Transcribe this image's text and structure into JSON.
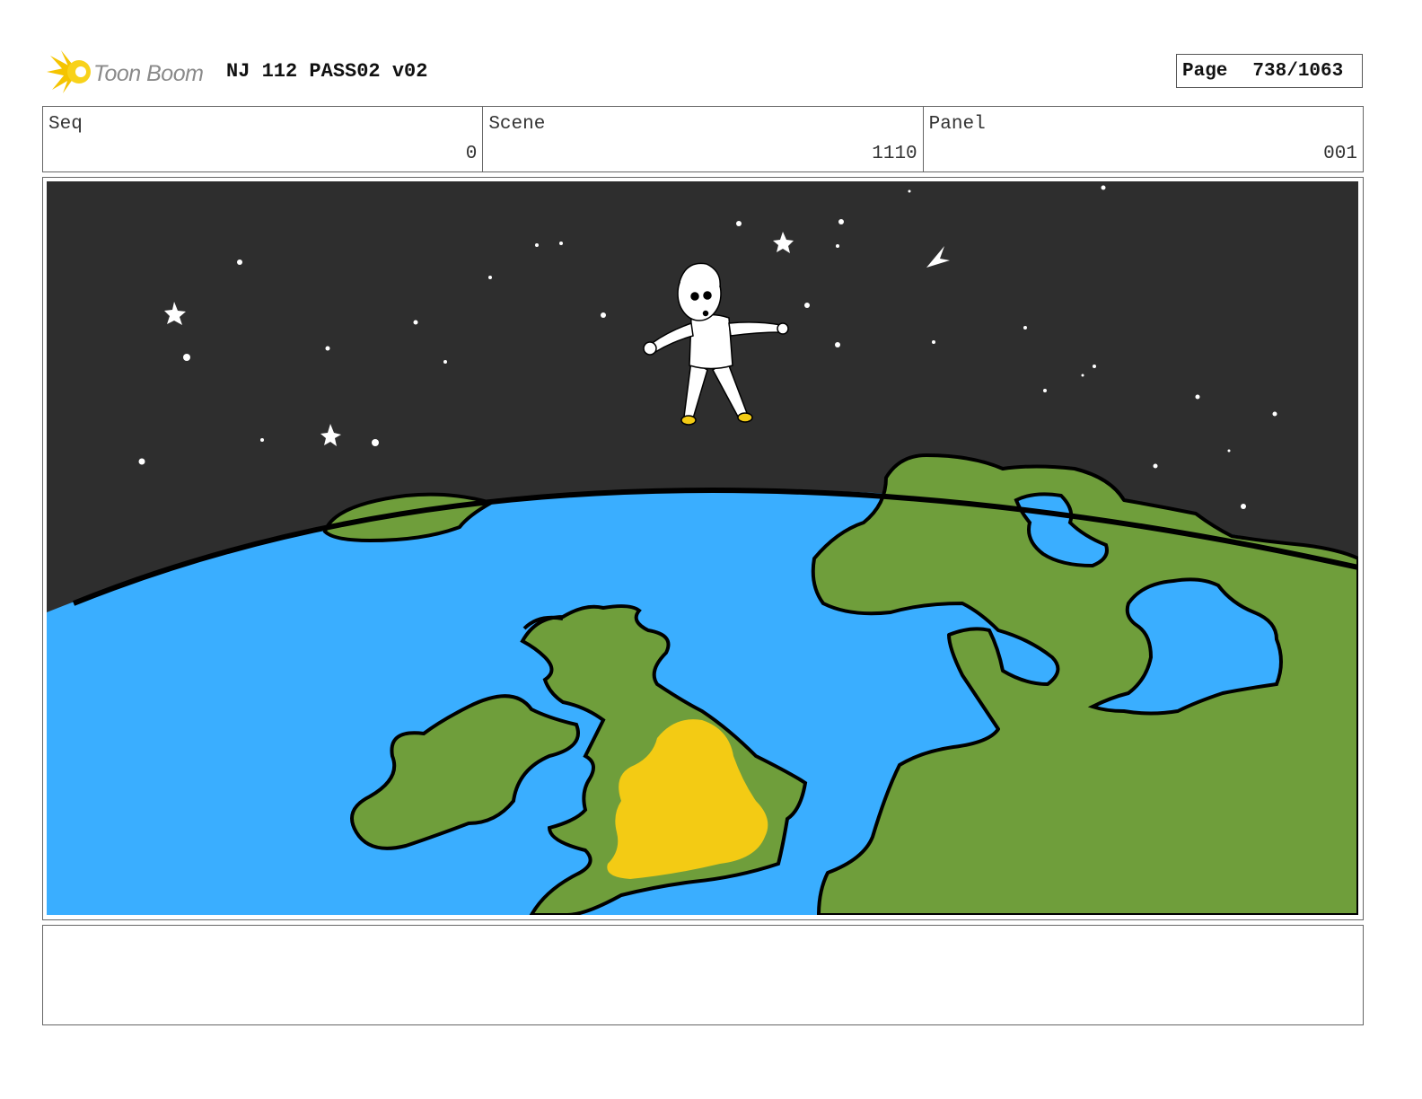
{
  "header": {
    "logo_text": "Toon Boom",
    "project_title": "NJ 112 PASS02 v02",
    "page_label": "Page",
    "page_number": "738/1063"
  },
  "info": {
    "seq_label": "Seq",
    "seq_value": "0",
    "scene_label": "Scene",
    "scene_value": "1110",
    "panel_label": "Panel",
    "panel_value": "001"
  },
  "colors": {
    "space": "#2e2e2e",
    "ocean": "#3aaeff",
    "land": "#6f9e3b",
    "highlight": "#f3cb14",
    "outline": "#000000",
    "logo_star": "#f5c400"
  },
  "icons": {
    "logo": "toon-boom-logo"
  },
  "notes": {
    "text": ""
  }
}
